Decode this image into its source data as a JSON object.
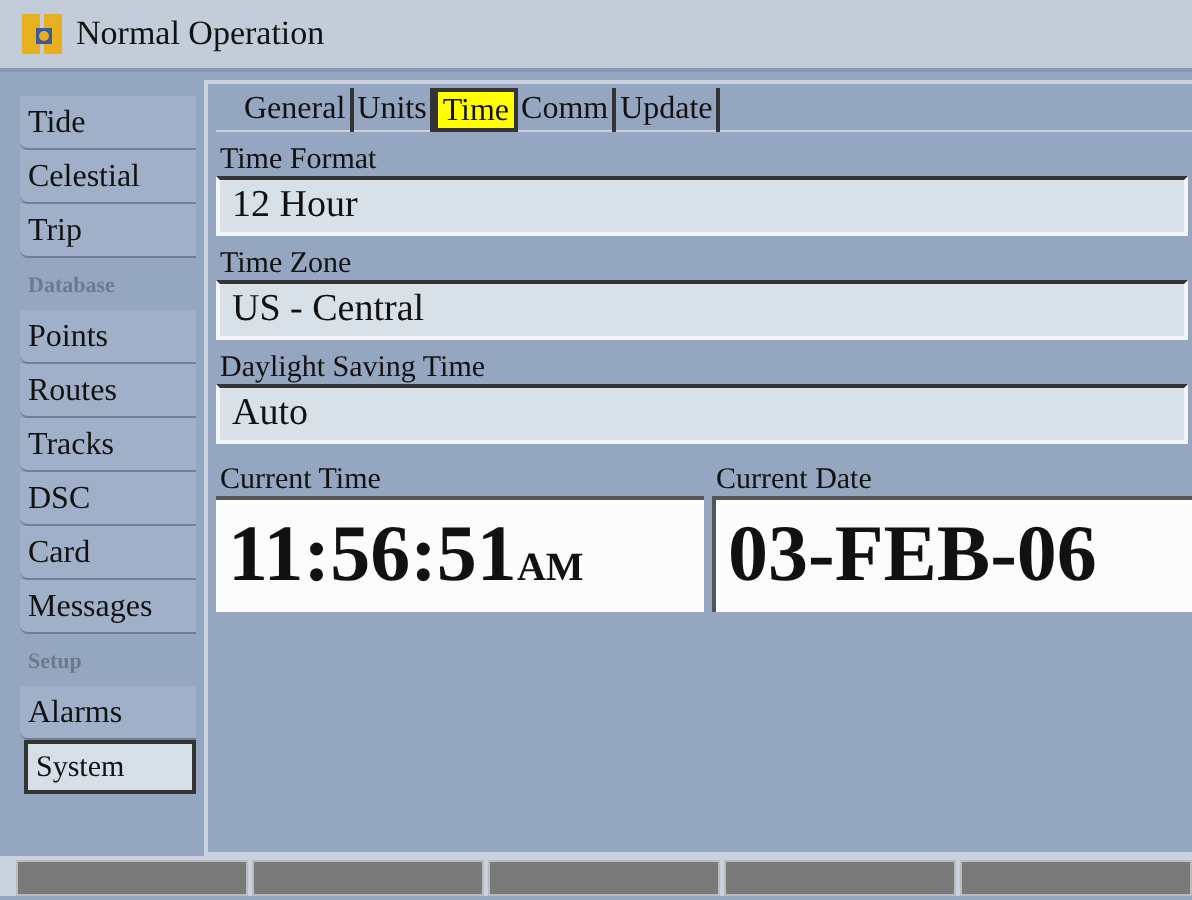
{
  "window": {
    "title": "Normal Operation"
  },
  "sidebar": {
    "items": [
      {
        "label": "Tide",
        "kind": "item",
        "selected": false
      },
      {
        "label": "Celestial",
        "kind": "item",
        "selected": false
      },
      {
        "label": "Trip",
        "kind": "item",
        "selected": false
      },
      {
        "label": "Database",
        "kind": "header"
      },
      {
        "label": "Points",
        "kind": "item",
        "selected": false
      },
      {
        "label": "Routes",
        "kind": "item",
        "selected": false
      },
      {
        "label": "Tracks",
        "kind": "item",
        "selected": false
      },
      {
        "label": "DSC",
        "kind": "item",
        "selected": false
      },
      {
        "label": "Card",
        "kind": "item",
        "selected": false
      },
      {
        "label": "Messages",
        "kind": "item",
        "selected": false
      },
      {
        "label": "Setup",
        "kind": "header"
      },
      {
        "label": "Alarms",
        "kind": "item",
        "selected": false
      },
      {
        "label": "System",
        "kind": "item",
        "selected": true
      }
    ]
  },
  "tabs": [
    {
      "label": "General",
      "selected": false
    },
    {
      "label": "Units",
      "selected": false
    },
    {
      "label": "Time",
      "selected": true
    },
    {
      "label": "Comm",
      "selected": false
    },
    {
      "label": "Update",
      "selected": false
    }
  ],
  "fields": [
    {
      "label": "Time Format",
      "value": "12 Hour"
    },
    {
      "label": "Time Zone",
      "value": "US - Central"
    },
    {
      "label": "Daylight Saving Time",
      "value": "Auto"
    }
  ],
  "current_time": {
    "label": "Current Time",
    "value": "11:56:51",
    "suffix": "AM"
  },
  "current_date": {
    "label": "Current Date",
    "value": "03-FEB-06"
  }
}
